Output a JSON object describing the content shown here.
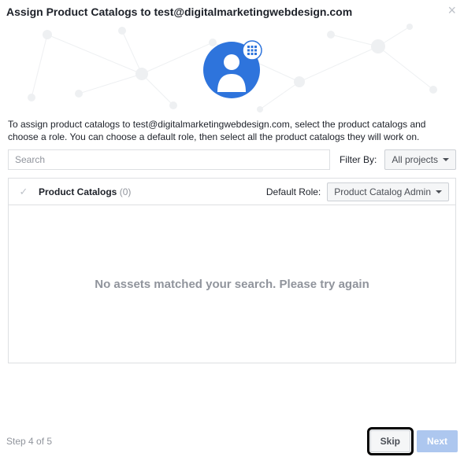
{
  "header": {
    "title": "Assign Product Catalogs to test@digitalmarketingwebdesign.com"
  },
  "description": "To assign product catalogs to test@digitalmarketingwebdesign.com, select the product catalogs and choose a role. You can choose a default role, then select all the product catalogs they will work on.",
  "search": {
    "placeholder": "Search"
  },
  "filter": {
    "label": "Filter By:",
    "selected": "All projects"
  },
  "table": {
    "title": "Product Catalogs",
    "count": "(0)",
    "role_label": "Default Role:",
    "role_selected": "Product Catalog Admin",
    "empty": "No assets matched your search. Please try again"
  },
  "footer": {
    "step": "Step 4 of 5",
    "skip": "Skip",
    "next": "Next"
  }
}
